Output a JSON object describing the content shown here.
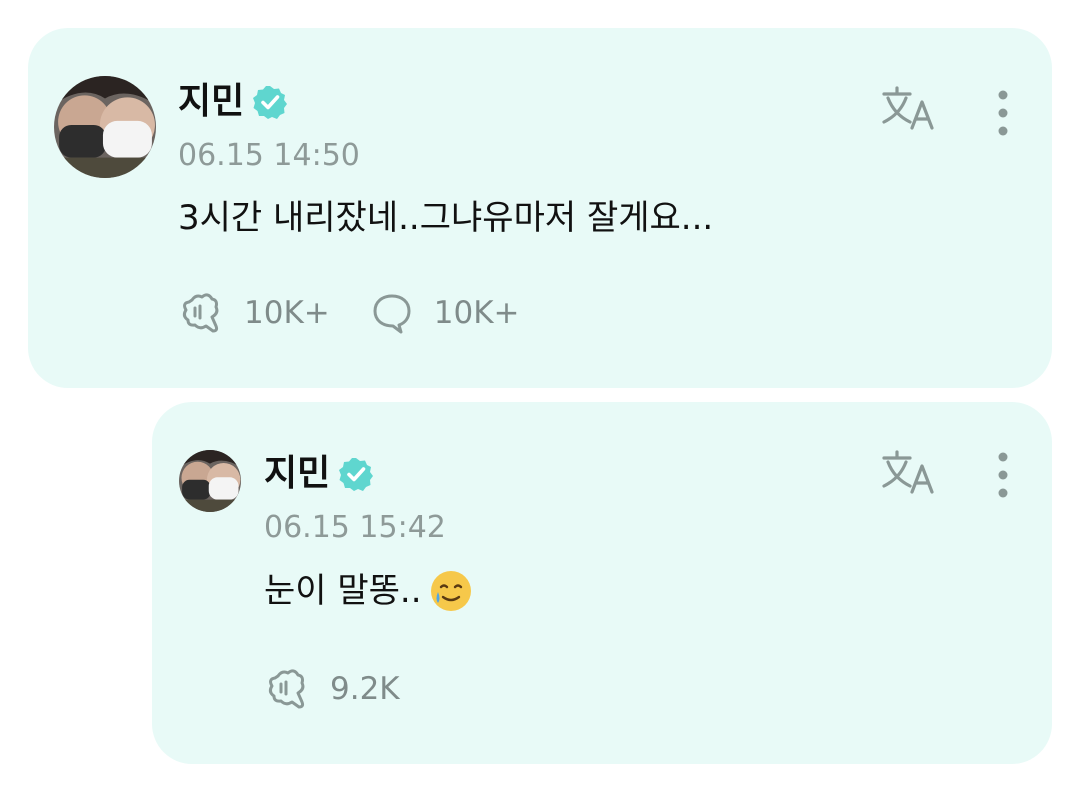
{
  "colors": {
    "card_bg": "#e8faf7",
    "verified": "#5fd6cf",
    "muted_text": "#8e9a98",
    "icon": "#8a9896"
  },
  "post": {
    "author": "지민",
    "verified_icon": "verified-badge-icon",
    "timestamp": "06.15 14:50",
    "text": "3시간 내리잤네..그냐유마저 잘게요...",
    "like_count": "10K+",
    "comment_count": "10K+",
    "like_icon": "like-icon",
    "comment_icon": "comment-icon",
    "translate_icon": "translate-icon",
    "more_icon": "more-vertical-icon"
  },
  "reply": {
    "author": "지민",
    "verified_icon": "verified-badge-icon",
    "timestamp": "06.15 15:42",
    "text": "눈이 말똥..",
    "emoji": "smiling-face-with-tear-emoji",
    "like_count": "9.2K",
    "like_icon": "like-icon",
    "translate_icon": "translate-icon",
    "more_icon": "more-vertical-icon"
  }
}
